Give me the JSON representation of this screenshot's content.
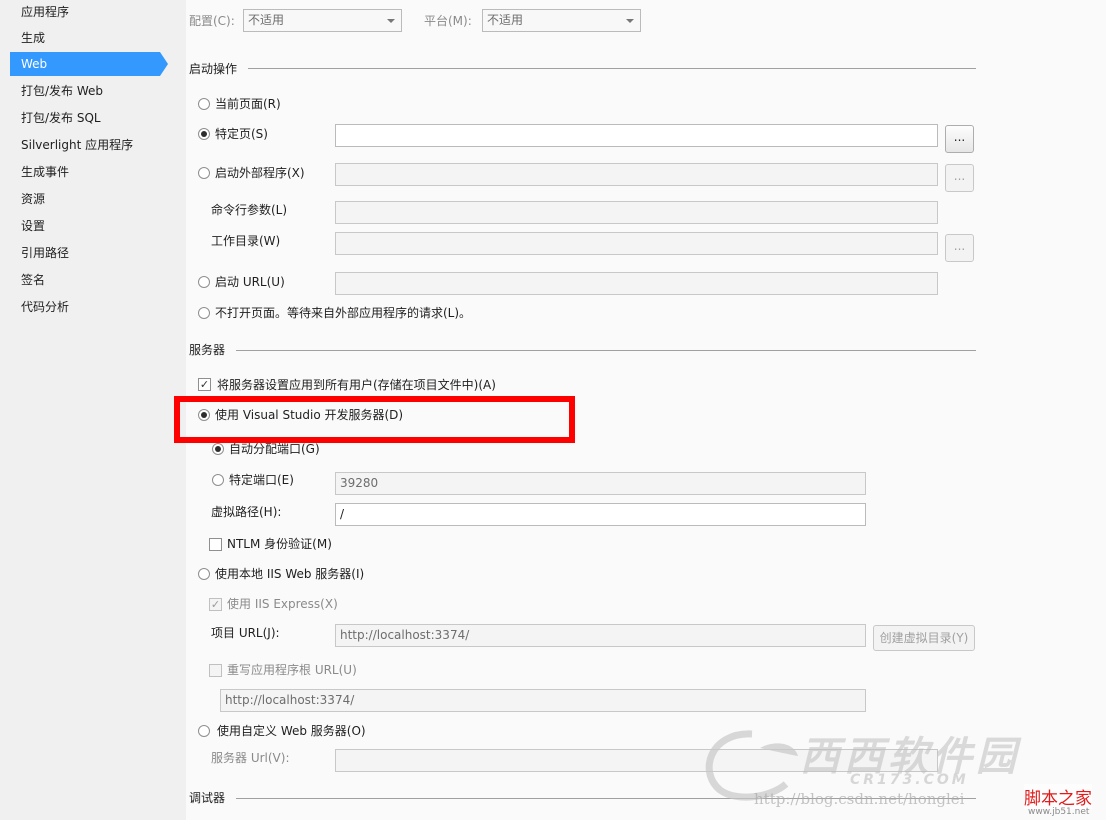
{
  "sidebar": {
    "items": [
      {
        "label": "应用程序",
        "active": false
      },
      {
        "label": "生成",
        "active": false
      },
      {
        "label": "Web",
        "active": true
      },
      {
        "label": "打包/发布 Web",
        "active": false
      },
      {
        "label": "打包/发布 SQL",
        "active": false
      },
      {
        "label": "Silverlight 应用程序",
        "active": false
      },
      {
        "label": "生成事件",
        "active": false
      },
      {
        "label": "资源",
        "active": false
      },
      {
        "label": "设置",
        "active": false
      },
      {
        "label": "引用路径",
        "active": false
      },
      {
        "label": "签名",
        "active": false
      },
      {
        "label": "代码分析",
        "active": false
      }
    ]
  },
  "header": {
    "config_label": "配置(C):",
    "config_value": "不适用",
    "platform_label": "平台(M):",
    "platform_value": "不适用"
  },
  "start_action": {
    "title": "启动操作",
    "current_page": "当前页面(R)",
    "specific_page": "特定页(S)",
    "specific_page_value": "",
    "browse_button": "...",
    "external_program": "启动外部程序(X)",
    "cmd_args": "命令行参数(L)",
    "working_dir": "工作目录(W)",
    "start_url": "启动 URL(U)",
    "dont_open": "不打开页面。等待来自外部应用程序的请求(L)。"
  },
  "servers": {
    "title": "服务器",
    "apply_all_users": "将服务器设置应用到所有用户(存储在项目文件中)(A)",
    "use_vs_server": "使用 Visual Studio 开发服务器(D)",
    "auto_assign_port": "自动分配端口(G)",
    "specific_port": "特定端口(E)",
    "port_value": "39280",
    "virtual_path_label": "虚拟路径(H):",
    "virtual_path_value": "/",
    "ntlm_auth": "NTLM 身份验证(M)",
    "use_local_iis": "使用本地 IIS Web 服务器(I)",
    "use_iis_express": "使用 IIS Express(X)",
    "project_url_label": "项目 URL(J):",
    "project_url_value": "http://localhost:3374/",
    "create_vdir_button": "创建虚拟目录(Y)",
    "override_root_url": "重写应用程序根 URL(U)",
    "override_url_value": "http://localhost:3374/",
    "use_custom_server": "使用自定义 Web 服务器(O)",
    "server_url_label": "服务器 Url(V):",
    "server_url_value": ""
  },
  "debuggers": {
    "title": "调试器"
  },
  "watermark": {
    "logo_text": "西西软件园",
    "logo_sub": "CR173.COM",
    "blog_url": "http://blog.csdn.net/honglei",
    "site_name": "脚本之家",
    "site_url": "www.jb51.net"
  },
  "colors": {
    "accent": "#3399ff",
    "highlight": "#ff0000"
  }
}
